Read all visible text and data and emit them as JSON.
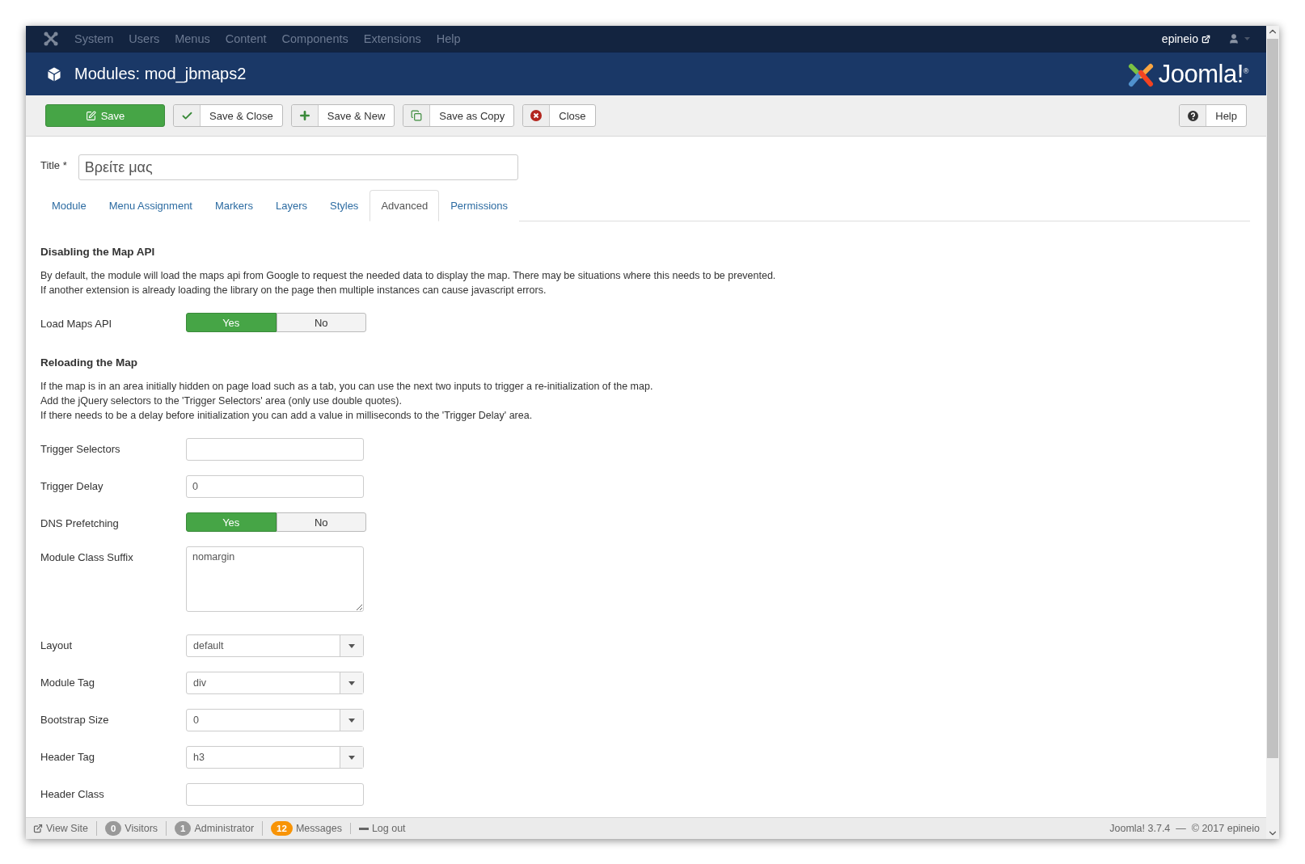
{
  "nav": {
    "menu": [
      "System",
      "Users",
      "Menus",
      "Content",
      "Components",
      "Extensions",
      "Help"
    ],
    "user": "epineio"
  },
  "header": {
    "title": "Modules: mod_jbmaps2",
    "logo": "Joomla!$^{®}$"
  },
  "toolbar": {
    "buttons": [
      {
        "label": "Save",
        "kind": "primary"
      },
      {
        "label": "Save & Close",
        "kind": "check"
      },
      {
        "label": "Save & New",
        "kind": "plus"
      },
      {
        "label": "Save as Copy",
        "kind": "copy"
      },
      {
        "label": "Close",
        "kind": "cancel"
      }
    ],
    "help": {
      "label": "Help"
    }
  },
  "title_field": {
    "label": "Title",
    "required": "*",
    "value": "Βρείτε μας"
  },
  "tabs": [
    {
      "label": "Module",
      "selected": false
    },
    {
      "label": "Menu Assignment",
      "selected": false
    },
    {
      "label": "Markers",
      "selected": false
    },
    {
      "label": "Layers",
      "selected": false
    },
    {
      "label": "Styles",
      "selected": false
    },
    {
      "label": "Advanced",
      "selected": true
    },
    {
      "label": "Permissions",
      "selected": false
    }
  ],
  "blocks": [
    {
      "kind": "heading",
      "text": "Disabling the Map API"
    },
    {
      "kind": "text",
      "lines": [
        "By default, the module will load the maps api from Google to request the needed data to display the map. There may be situations where this needs to be prevented.",
        "If another extension is already loading the library on the page then multiple instances can cause javascript errors."
      ]
    },
    {
      "kind": "toggle",
      "label": "Load Maps API",
      "options": [
        {
          "label": "Yes",
          "selected": true
        },
        {
          "label": "No",
          "selected": false
        }
      ]
    },
    {
      "kind": "heading",
      "text": "Reloading the Map"
    },
    {
      "kind": "text",
      "lines": [
        "If the map is in an area initially hidden on page load such as a tab, you can use the next two inputs to trigger a re-initialization of the map.",
        "Add the jQuery selectors to the 'Trigger Selectors' area (only use double quotes).",
        "If there needs to be a delay before initialization you can add a value in milliseconds to the 'Trigger Delay' area."
      ]
    },
    {
      "kind": "input",
      "label": "Trigger Selectors"
    },
    {
      "kind": "input",
      "label": "Trigger Delay",
      "value": "0"
    },
    {
      "kind": "toggle",
      "label": "DNS Prefetching",
      "options": [
        {
          "label": "Yes",
          "selected": true
        },
        {
          "label": "No",
          "selected": false
        }
      ]
    },
    {
      "kind": "textarea",
      "label": "Module Class Suffix",
      "value": "nomargin"
    },
    {
      "kind": "select",
      "label": "Layout",
      "value": "default"
    },
    {
      "kind": "select",
      "label": "Module Tag",
      "value": "div"
    },
    {
      "kind": "select",
      "label": "Bootstrap Size",
      "value": "0"
    },
    {
      "kind": "select",
      "label": "Header Tag",
      "value": "h3"
    },
    {
      "kind": "input",
      "label": "Header Class"
    }
  ],
  "footer": {
    "items": [
      {
        "kind": "link",
        "label": "View Site"
      },
      {
        "kind": "badge",
        "count": "0",
        "label": "Visitors",
        "color": "#999999"
      },
      {
        "kind": "badge",
        "count": "1",
        "label": "Administrator",
        "color": "#999999"
      },
      {
        "kind": "badge",
        "count": "12",
        "label": "Messages",
        "color": "#f89406"
      },
      {
        "kind": "logout",
        "label": "Log out"
      }
    ],
    "copyright": "Joomla! 3.7.4  —  © 2017 epineio"
  }
}
